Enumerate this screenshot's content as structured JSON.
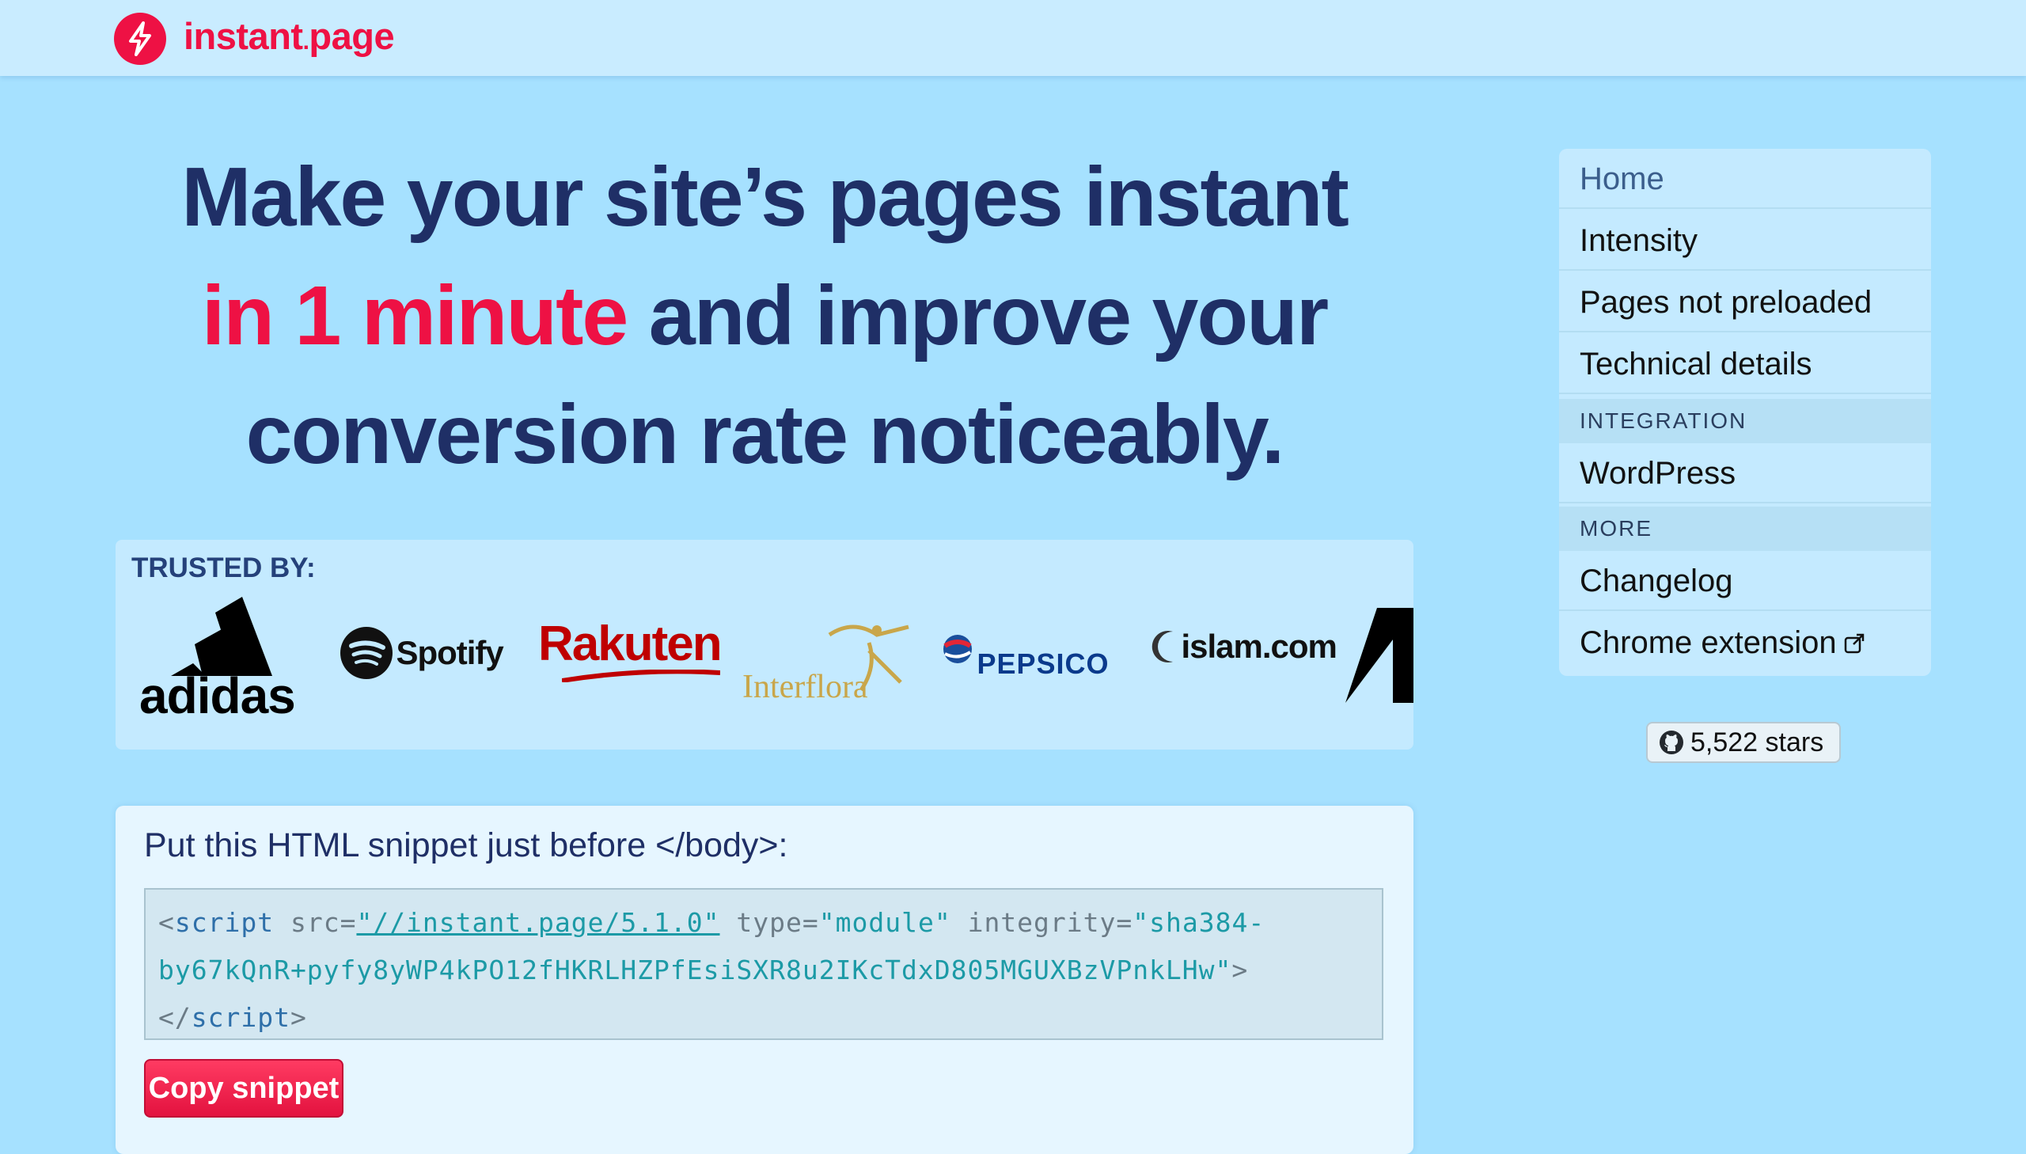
{
  "header": {
    "logo_name": "instant",
    "logo_dot": ".",
    "logo_suffix": "page",
    "logo_icon": "lightning-bolt-icon",
    "brand_color": "#ee1144"
  },
  "hero": {
    "line1": "Make your site’s pages instant",
    "line2_highlight": "in 1 minute",
    "line2_rest": " and improve your",
    "line3": "conversion rate noticeably."
  },
  "trusted": {
    "label": "TRUSTED BY:",
    "brands": [
      "adidas",
      "Spotify",
      "Rakuten",
      "Interflora",
      "PEPSICO",
      "islam.com"
    ]
  },
  "snippet": {
    "title": "Put this HTML snippet just before </body>:",
    "code_open": "<",
    "code_tag": "script",
    "code_src_attr": " src=",
    "code_src_val": "\"//instant.page/5.1.0\"",
    "code_type_attr": " type=",
    "code_type_val": "\"module\"",
    "code_integrity_attr": " integrity=",
    "code_integrity_val1": "\"sha384-",
    "code_integrity_val2": "by67kQnR+pyfy8yWP4kPO12fHKRLHZPfEsiSXR8u2IKcTdxD805MGUXBzVPnkLHw\"",
    "code_close1": ">",
    "code_end_open": "</",
    "code_end_tag": "script",
    "code_end_close": ">",
    "copy_label": "Copy snippet"
  },
  "nav": {
    "items": [
      {
        "label": "Home"
      },
      {
        "label": "Intensity"
      },
      {
        "label": "Pages not preloaded"
      },
      {
        "label": "Technical details"
      }
    ],
    "section_integration": "INTEGRATION",
    "integration_items": [
      {
        "label": "WordPress"
      }
    ],
    "section_more": "MORE",
    "more_items": [
      {
        "label": "Changelog"
      },
      {
        "label": "Chrome extension"
      }
    ]
  },
  "github": {
    "stars_label": "5,522 stars",
    "icon": "github-icon"
  }
}
